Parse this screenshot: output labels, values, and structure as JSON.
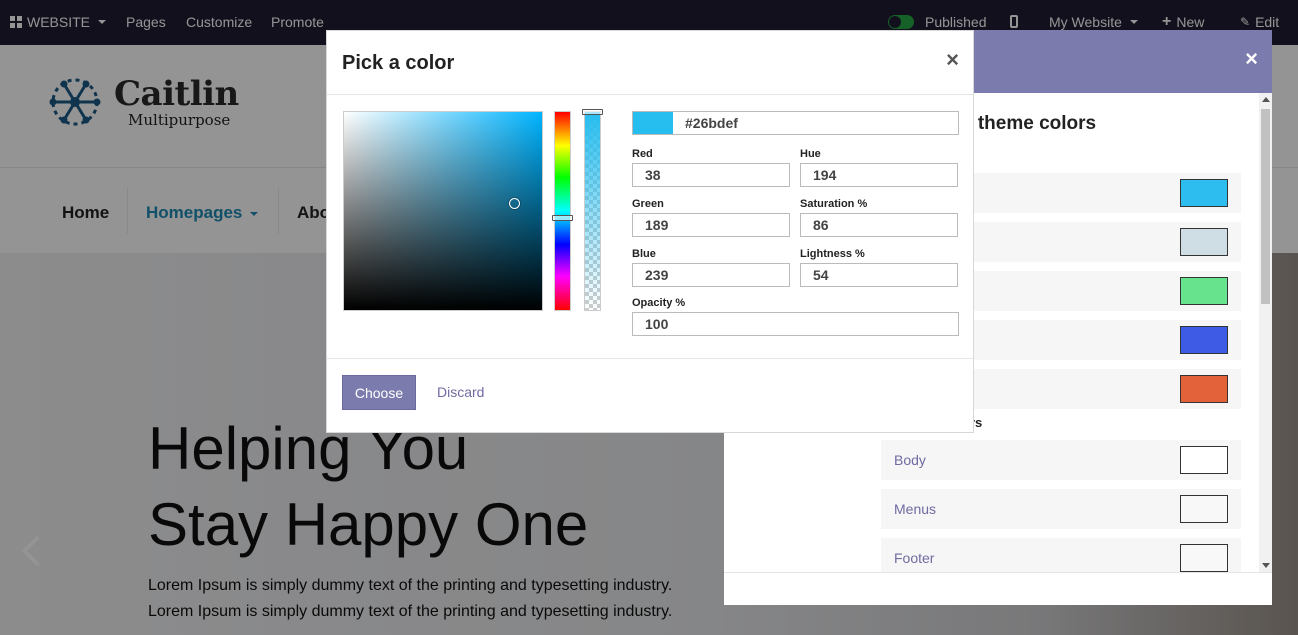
{
  "admin_bar": {
    "website_label": "WEBSITE",
    "pages_label": "Pages",
    "customize_label": "Customize",
    "promote_label": "Promote",
    "published_label": "Published",
    "my_website_label": "My Website",
    "new_label": "New",
    "edit_label": "Edit"
  },
  "site": {
    "logo_name": "Caitlin",
    "logo_sub": "Multipurpose",
    "nav": {
      "home": "Home",
      "homepages": "Homepages",
      "about": "Abo"
    },
    "hero": {
      "title_line1": "Helping You",
      "title_line2": "Stay Happy One",
      "text_line1": "Lorem Ipsum is simply dummy text of the printing and typesetting industry.",
      "text_line2": "Lorem Ipsum is simply dummy text of the printing and typesetting industry."
    }
  },
  "theme_dialog": {
    "title": "e theme colors",
    "subtitle": "ors",
    "close_icon": "×",
    "swatches": [
      "#2ebdef",
      "#cfdde4",
      "#67e38e",
      "#3e5be6",
      "#e3623a"
    ],
    "named_rows": [
      {
        "label": "Body",
        "color": "#ffffff"
      },
      {
        "label": "Menus",
        "color": "#f8f8f8"
      },
      {
        "label": "Footer",
        "color": "#f8f8f8"
      }
    ]
  },
  "picker": {
    "title": "Pick a color",
    "close_icon": "×",
    "current_color": "#26bdef",
    "hex_value": "#26bdef",
    "fields": {
      "red_label": "Red",
      "red": "38",
      "green_label": "Green",
      "green": "189",
      "blue_label": "Blue",
      "blue": "239",
      "hue_label": "Hue",
      "hue": "194",
      "saturation_label": "Saturation %",
      "saturation": "86",
      "lightness_label": "Lightness %",
      "lightness": "54",
      "opacity_label": "Opacity %",
      "opacity": "100"
    },
    "choose_label": "Choose",
    "discard_label": "Discard"
  },
  "colors": {
    "accent": "#7c7bad",
    "link": "#6f6ba2",
    "topbar": "#1f1c33"
  }
}
